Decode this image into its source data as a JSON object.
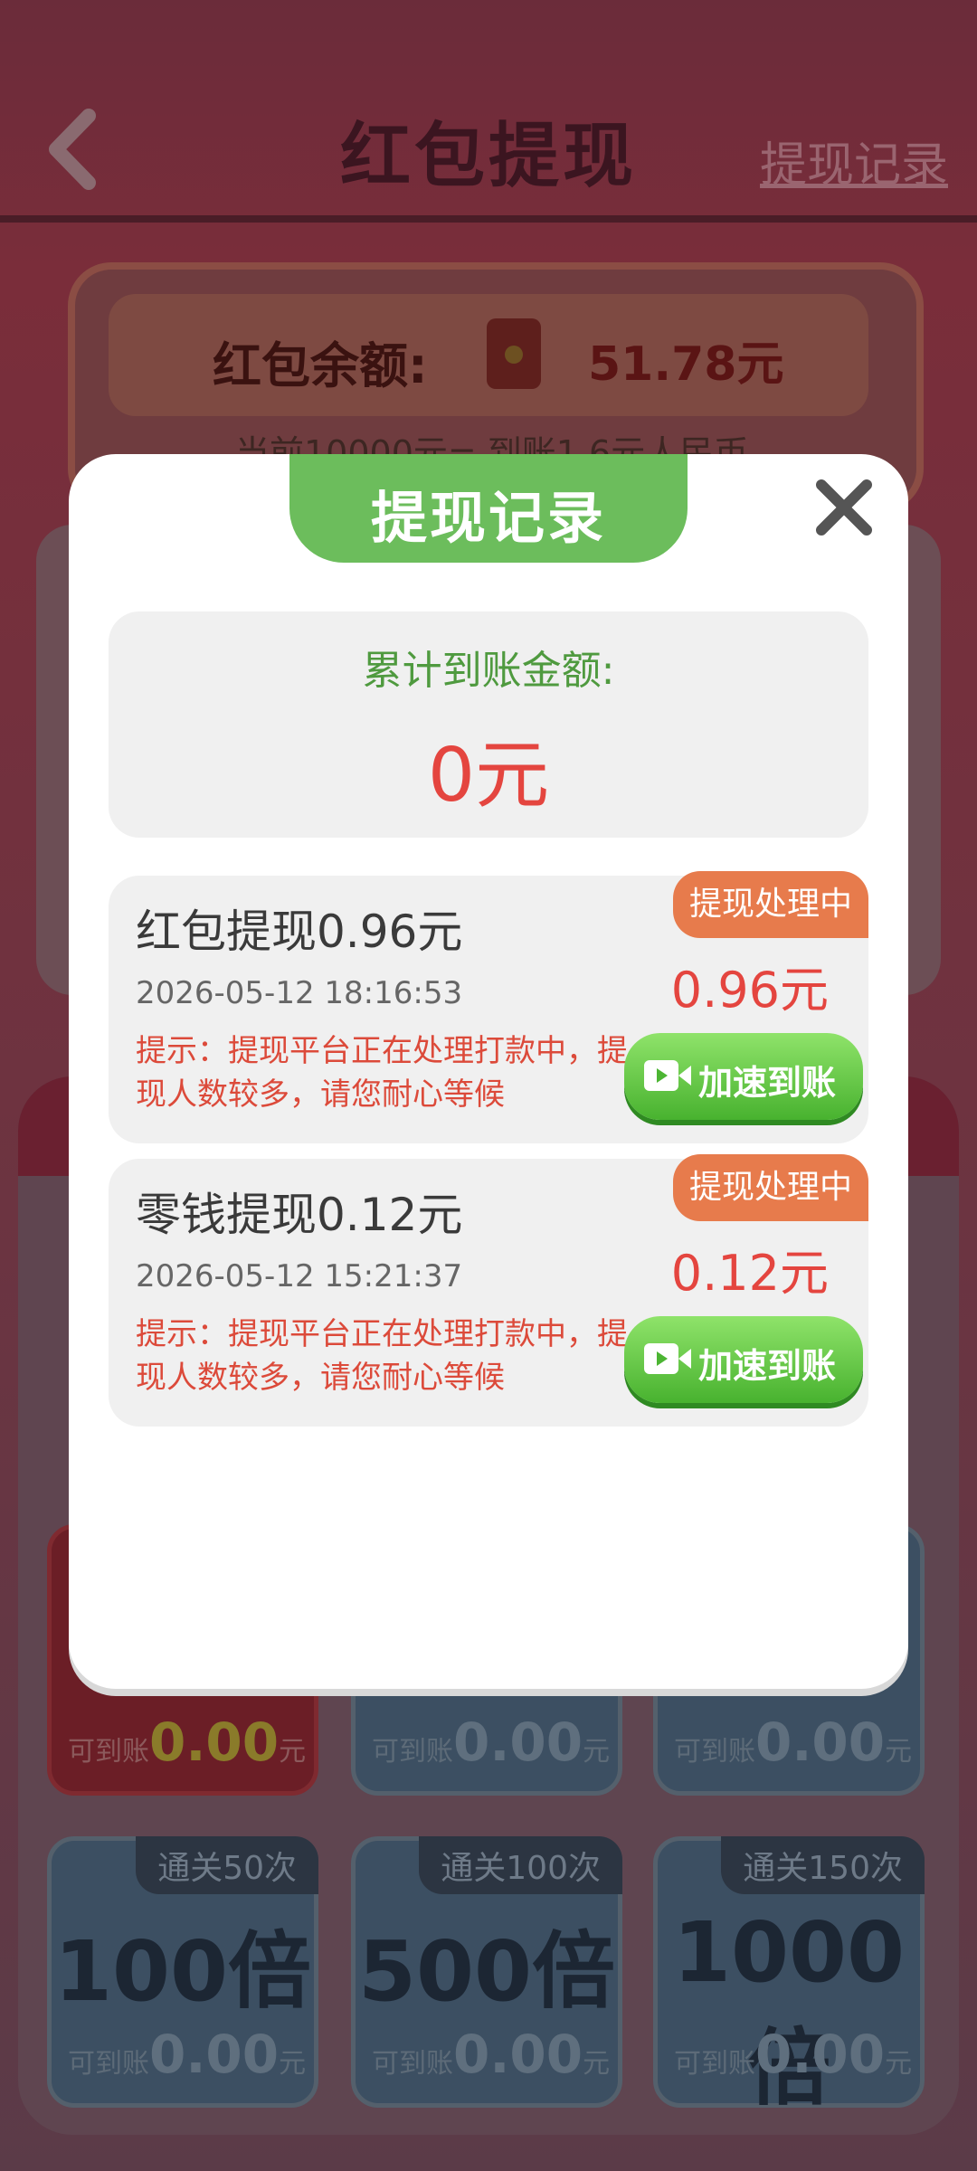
{
  "header": {
    "title": "红包提现",
    "record_link": "提现记录"
  },
  "balance": {
    "label": "红包余额:",
    "value": "51.78元",
    "sub_text": "当前10000元= 到账1.6元人民币"
  },
  "tiles": {
    "row1": [
      {
        "foot_label": "可到账",
        "amount": "0.00",
        "unit": "元"
      },
      {
        "foot_label": "可到账",
        "amount": "0.00",
        "unit": "元"
      },
      {
        "foot_label": "可到账",
        "amount": "0.00",
        "unit": "元"
      }
    ],
    "row2": [
      {
        "tag": "通关50次",
        "multiplier": "100倍",
        "foot_label": "可到账",
        "amount": "0.00",
        "unit": "元"
      },
      {
        "tag": "通关100次",
        "multiplier": "500倍",
        "foot_label": "可到账",
        "amount": "0.00",
        "unit": "元"
      },
      {
        "tag": "通关150次",
        "multiplier": "1000倍",
        "foot_label": "可到账",
        "amount": "0.00",
        "unit": "元"
      }
    ]
  },
  "modal": {
    "title": "提现记录",
    "total_label": "累计到账金额:",
    "total_value": "0元",
    "records": [
      {
        "title": "红包提现0.96元",
        "time": "2026-05-12 18:16:53",
        "status": "提现处理中",
        "amount": "0.96元",
        "tip": "提示：提现平台正在处理打款中，提现人数较多，请您耐心等候",
        "button": "加速到账"
      },
      {
        "title": "零钱提现0.12元",
        "time": "2026-05-12 15:21:37",
        "status": "提现处理中",
        "amount": "0.12元",
        "tip": "提示：提现平台正在处理打款中，提现人数较多，请您耐心等候",
        "button": "加速到账"
      }
    ]
  },
  "colors": {
    "accent_green": "#6cbd5c",
    "amount_red": "#e4453f",
    "status_orange": "#e77b4c"
  }
}
